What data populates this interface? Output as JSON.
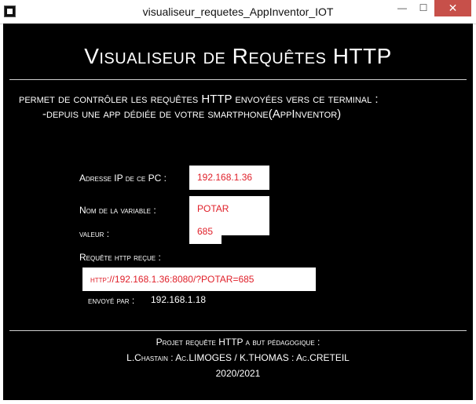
{
  "window": {
    "title": "visualiseur_requetes_AppInventor_IOT",
    "minimize": "—",
    "maximize": "☐",
    "close": "✕"
  },
  "main": {
    "heading": "Visualiseur de Requêtes HTTP",
    "description_line1": "permet de contrôler les requêtes HTTP envoyées vers ce terminal :",
    "description_line2": "-depuis une app dédiée de votre smartphone(AppInventor)"
  },
  "fields": {
    "ip_label": "Adresse IP de ce PC :",
    "ip_value": "192.168.1.36",
    "variable_label": "Nom de la variable :",
    "variable_value": "POTAR",
    "value_label": "valeur :",
    "value_value": "685",
    "request_label": "Requête http reçue :",
    "request_value": "http://192.168.1.36:8080/?POTAR=685",
    "sender_label": "envoyé par :",
    "sender_value": "192.168.1.18"
  },
  "footer": {
    "line1": "Projet requête HTTP a but pédagogique :",
    "line2": "L.Chastain : Ac.LIMOGES / K.THOMAS : Ac.CRETEIL",
    "line3": "2020/2021"
  },
  "colors": {
    "background": "#000000",
    "text": "#ffffff",
    "value_text": "#e0202a",
    "close_button": "#c7504a"
  }
}
